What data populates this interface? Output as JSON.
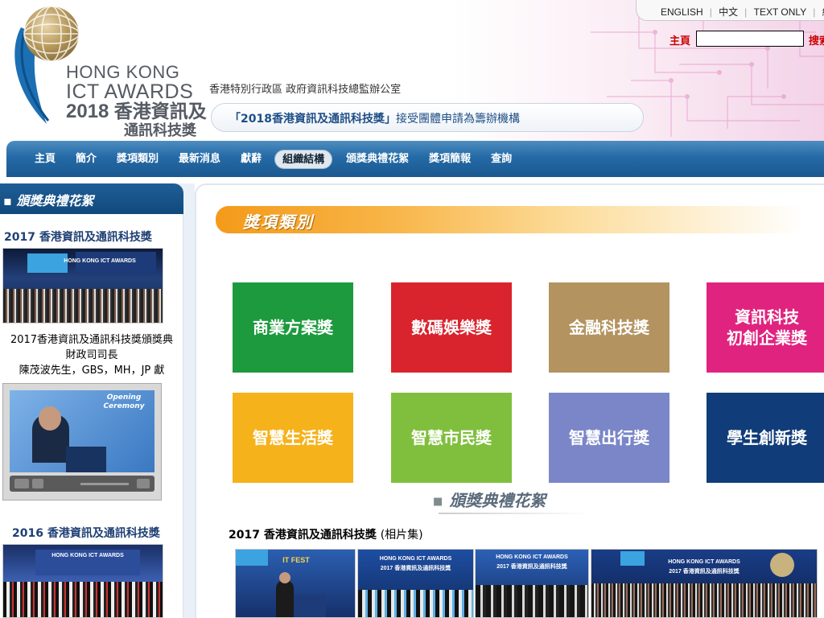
{
  "header": {
    "logo_line1": "HONG KONG",
    "logo_line2": "ICT AWARDS",
    "logo_year": "2018",
    "logo_zh1": "香港資訊及",
    "logo_zh2": "通訊科技獎",
    "dept_name": "香港特別行政區 政府資訊科技總監辦公室",
    "announcement_bold": "「2018香港資訊及通訊科技獎」",
    "announcement_rest": "接受團體申請為籌辦機構"
  },
  "lang": {
    "english": "ENGLISH",
    "chinese": "中文",
    "text_only": "TEXT ONLY",
    "partial": "純"
  },
  "search": {
    "home_label": "主頁",
    "placeholder": "",
    "button_label": "搜索"
  },
  "nav": {
    "items": [
      {
        "label": "主頁"
      },
      {
        "label": "簡介"
      },
      {
        "label": "獎項類別"
      },
      {
        "label": "最新消息"
      },
      {
        "label": "獻辭"
      },
      {
        "label": "組織結構"
      },
      {
        "label": "頒獎典禮花絮"
      },
      {
        "label": "獎項簡報"
      },
      {
        "label": "查詢"
      }
    ],
    "active_index": 5
  },
  "sidebar": {
    "heading": "頒獎典禮花絮",
    "year1_title": "2017 香港資訊及通訊科技獎",
    "video_caption_line1": "2017香港資訊及通訊科技獎頒獎典",
    "video_caption_line2": "財政司司長",
    "video_caption_line3": "陳茂波先生，GBS，MH，JP 獻",
    "video_opening_text": "Opening Ceremony",
    "year2_title": "2016 香港資訊及通訊科技獎"
  },
  "main": {
    "section_title": "獎項類別",
    "awards": [
      {
        "label": "商業方案獎",
        "color": "#1d9a3e"
      },
      {
        "label": "數碼娛樂獎",
        "color": "#d9232d"
      },
      {
        "label": "金融科技獎",
        "color": "#b39360"
      },
      {
        "label": "資訊科技\n初創企業獎",
        "color": "#e0237f"
      },
      {
        "label": "智慧生活獎",
        "color": "#f5b21b"
      },
      {
        "label": "智慧市民獎",
        "color": "#80bf3d"
      },
      {
        "label": "智慧出行獎",
        "color": "#7a86c8"
      },
      {
        "label": "學生創新獎",
        "color": "#103d79"
      }
    ],
    "gallery_title": "頒獎典禮花絮",
    "photo_set_bold": "2017 香港資訊及通訊科技獎",
    "photo_set_plain": "(相片集)",
    "banner_text_a": "HONG KONG ICT AWARDS",
    "banner_text_b": "2017 香港資訊及通訊科技獎",
    "banner_text_c": "IT FEST"
  },
  "colors": {
    "nav_blue": "#246aa6",
    "sidebar_head": "#1e5e96",
    "section_orange": "#f49a1a",
    "link_red": "#cc0000"
  },
  "icons": [
    "globe-logo-icon",
    "play-icon",
    "volume-icon"
  ]
}
